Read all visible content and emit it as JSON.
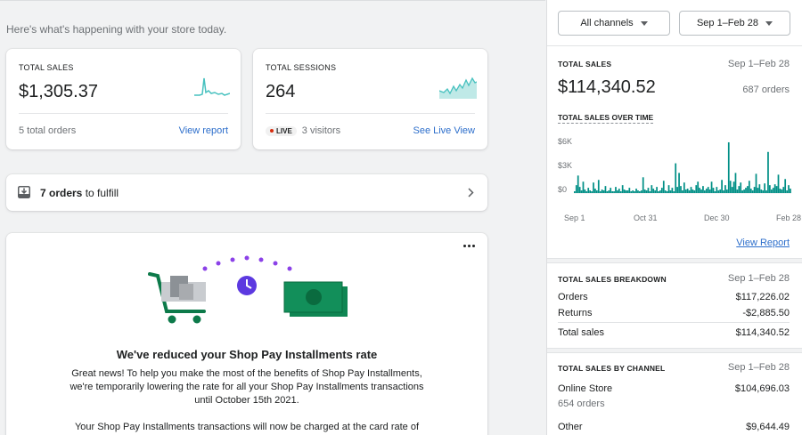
{
  "greeting": "Here's what's happening with your store today.",
  "total_sales_card": {
    "label": "TOTAL SALES",
    "value": "$1,305.37",
    "footer": "5 total orders",
    "link": "View report",
    "sparkline_color": "#47c1bf"
  },
  "total_sessions_card": {
    "label": "TOTAL SESSIONS",
    "value": "264",
    "live_badge": "LIVE",
    "visitors": "3 visitors",
    "link": "See Live View",
    "sparkline_color": "#47c1bf"
  },
  "fulfill": {
    "count_text": "7 orders",
    "suffix": " to fulfill"
  },
  "promo": {
    "menu_icon": "more-horizontal-icon",
    "title": "We've reduced your Shop Pay Installments rate",
    "body": "Great news! To help you make the most of the benefits of Shop Pay Installments, we're temporarily lowering the rate for all your Shop Pay Installments transactions until October 15th 2021.",
    "body2": "Your Shop Pay Installments transactions will now be charged at the card rate of"
  },
  "right_panel": {
    "channel_select": "All channels",
    "date_select": "Sep 1–Feb 28",
    "total_sales": {
      "label": "TOTAL SALES",
      "date": "Sep 1–Feb 28",
      "value": "$114,340.52",
      "orders": "687 orders"
    },
    "chart_title": "TOTAL SALES OVER TIME",
    "view_report": "View Report",
    "breakdown": {
      "label": "TOTAL SALES BREAKDOWN",
      "date": "Sep 1–Feb 28",
      "rows": [
        {
          "label": "Orders",
          "value": "$117,226.02"
        },
        {
          "label": "Returns",
          "value": "-$2,885.50"
        },
        {
          "label": "Total sales",
          "value": "$114,340.52"
        }
      ]
    },
    "by_channel": {
      "label": "TOTAL SALES BY CHANNEL",
      "date": "Sep 1–Feb 28",
      "rows": [
        {
          "label": "Online Store",
          "value": "$104,696.03",
          "sub": "654 orders"
        },
        {
          "label": "Other",
          "value": "$9,644.49"
        }
      ]
    }
  },
  "chart_data": {
    "type": "area",
    "title": "TOTAL SALES OVER TIME",
    "color": "#008f86",
    "yticks": [
      "$0",
      "$3K",
      "$6K"
    ],
    "ylim": [
      0,
      6000
    ],
    "xticks": [
      "Sep 1",
      "Oct 31",
      "Dec 30",
      "Feb 28"
    ],
    "x": [
      "Sep 1",
      "Oct 31",
      "Dec 30",
      "Feb 28"
    ],
    "values": [
      200,
      900,
      2000,
      700,
      300,
      1300,
      400,
      200,
      600,
      300,
      200,
      1200,
      500,
      300,
      1500,
      200,
      400,
      300,
      800,
      200,
      300,
      600,
      200,
      200,
      700,
      300,
      500,
      200,
      900,
      400,
      300,
      300,
      600,
      200,
      300,
      200,
      500,
      300,
      200,
      300,
      1800,
      400,
      300,
      600,
      200,
      900,
      500,
      300,
      700,
      200,
      300,
      600,
      1400,
      300,
      200,
      900,
      300,
      600,
      200,
      3400,
      700,
      2300,
      800,
      300,
      1200,
      400,
      500,
      300,
      700,
      400,
      300,
      900,
      1300,
      600,
      400,
      800,
      300,
      500,
      700,
      400,
      1300,
      600,
      200,
      700,
      300,
      400,
      1500,
      300,
      900,
      400,
      5800,
      1400,
      700,
      1300,
      2300,
      400,
      800,
      1200,
      300,
      400,
      600,
      800,
      1400,
      500,
      300,
      700,
      2200,
      600,
      1000,
      400,
      300,
      1100,
      300,
      4700,
      900,
      400,
      600,
      1000,
      800,
      2100,
      500,
      400,
      700,
      1600,
      300,
      900,
      500
    ]
  }
}
